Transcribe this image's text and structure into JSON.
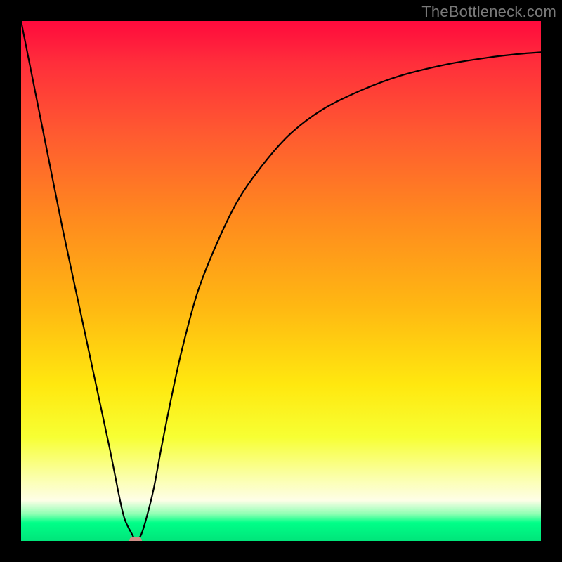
{
  "watermark": "TheBottleneck.com",
  "chart_data": {
    "type": "line",
    "title": "",
    "xlabel": "",
    "ylabel": "",
    "xlim": [
      0,
      100
    ],
    "ylim": [
      0,
      100
    ],
    "grid": false,
    "legend": false,
    "gradient_stops": [
      {
        "pos": 0,
        "color": "#ff0a3d"
      },
      {
        "pos": 8,
        "color": "#ff2e3b"
      },
      {
        "pos": 22,
        "color": "#ff5b30"
      },
      {
        "pos": 38,
        "color": "#ff8a1e"
      },
      {
        "pos": 55,
        "color": "#ffb812"
      },
      {
        "pos": 70,
        "color": "#ffe80f"
      },
      {
        "pos": 80,
        "color": "#f7ff33"
      },
      {
        "pos": 88,
        "color": "#fbffae"
      },
      {
        "pos": 92.2,
        "color": "#fefee7"
      },
      {
        "pos": 94.8,
        "color": "#8fffb3"
      },
      {
        "pos": 96.5,
        "color": "#00ff88"
      },
      {
        "pos": 100,
        "color": "#00e57a"
      }
    ],
    "series": [
      {
        "name": "bottleneck-curve",
        "color": "#000000",
        "x": [
          0,
          2,
          5,
          8,
          11,
          14,
          17,
          19,
          20,
          21.5,
          22,
          23,
          24,
          25.5,
          27,
          29,
          31,
          34,
          38,
          42,
          47,
          52,
          58,
          65,
          73,
          82,
          90,
          96,
          100
        ],
        "y": [
          100,
          90,
          75,
          60,
          46,
          32,
          18,
          8,
          4,
          1,
          0,
          1,
          4,
          10,
          18,
          28,
          37,
          48,
          58,
          66,
          73,
          78.5,
          83,
          86.5,
          89.5,
          91.7,
          93,
          93.7,
          94
        ]
      }
    ],
    "marker": {
      "name": "optimal-point",
      "x": 22,
      "y": 0,
      "color": "#cf8d86"
    }
  }
}
